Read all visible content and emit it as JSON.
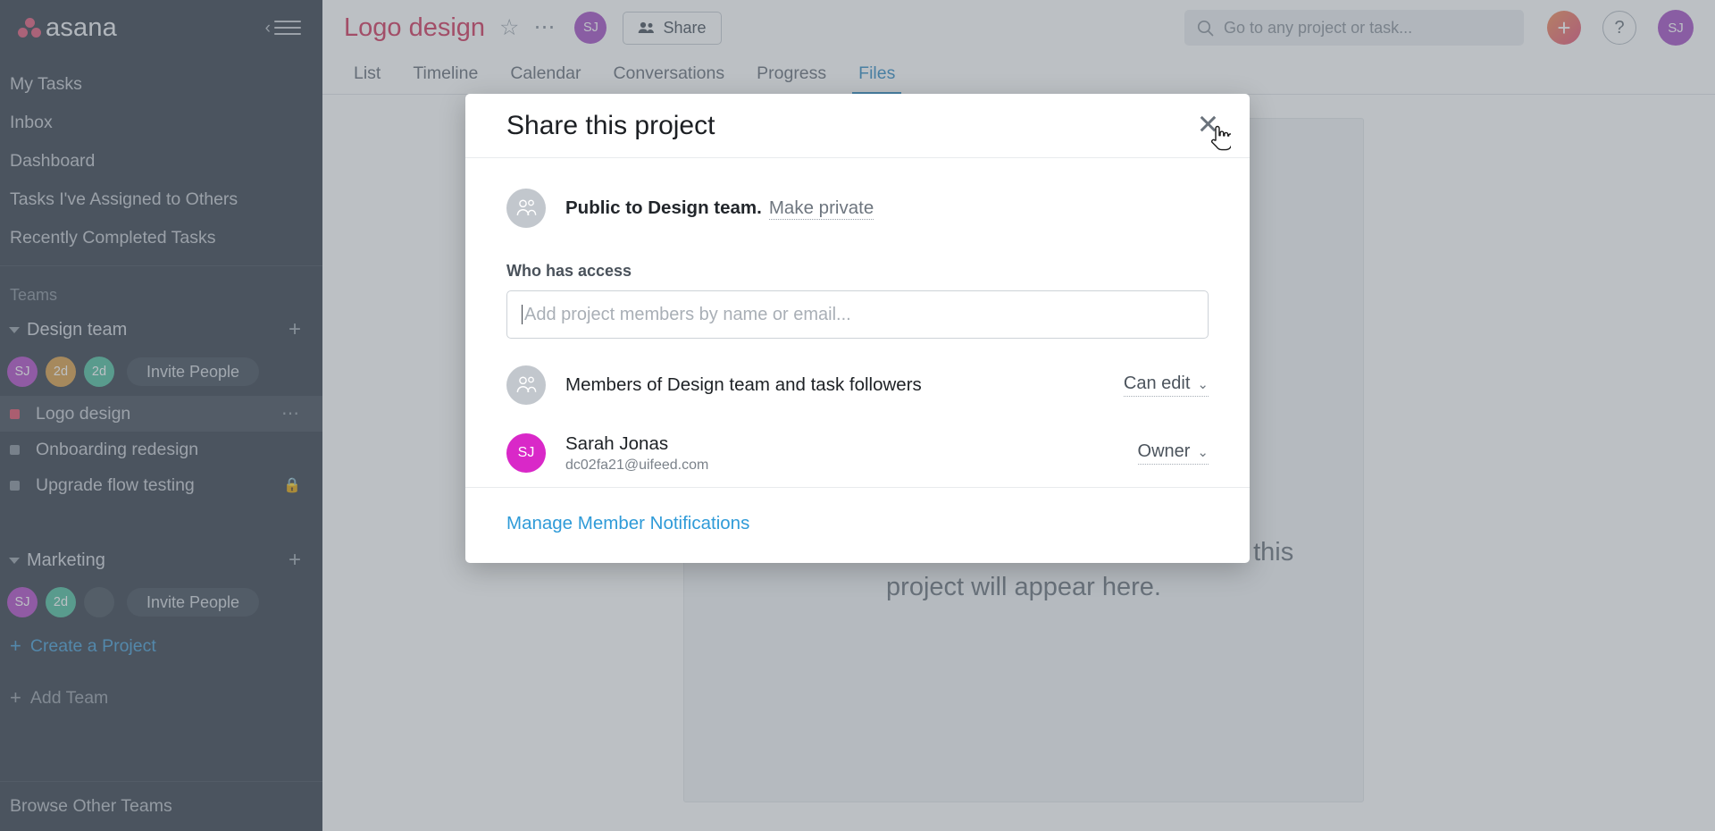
{
  "sidebar": {
    "logo_text": "asana",
    "collapse_icon": "collapse-sidebar-icon",
    "nav": [
      {
        "label": "My Tasks"
      },
      {
        "label": "Inbox"
      },
      {
        "label": "Dashboard"
      },
      {
        "label": "Tasks I've Assigned to Others"
      },
      {
        "label": "Recently Completed Tasks"
      }
    ],
    "teams_label": "Teams",
    "teams": [
      {
        "name": "Design team",
        "add_icon": "plus-icon",
        "avatars": [
          {
            "initials": "SJ",
            "color": "#b452c8"
          },
          {
            "initials": "2d",
            "color": "#daa04e"
          },
          {
            "initials": "2d",
            "color": "#55bfa1"
          }
        ],
        "invite_label": "Invite People",
        "projects": [
          {
            "name": "Logo design",
            "dot_color": "#e0566f",
            "active": true,
            "trailing": "more-options-icon"
          },
          {
            "name": "Onboarding redesign",
            "dot_color": "#8a939d",
            "active": false,
            "trailing": ""
          },
          {
            "name": "Upgrade flow testing",
            "dot_color": "#8a939d",
            "active": false,
            "trailing": "lock-icon"
          }
        ]
      },
      {
        "name": "Marketing",
        "add_icon": "plus-icon",
        "avatars": [
          {
            "initials": "SJ",
            "color": "#b452c8"
          },
          {
            "initials": "2d",
            "color": "#55bfa1"
          },
          {
            "initials": "",
            "color": "#4c5661"
          }
        ],
        "invite_label": "Invite People",
        "projects": []
      }
    ],
    "create_project_label": "Create a Project",
    "add_team_label": "Add Team",
    "browse_teams_label": "Browse Other Teams"
  },
  "header": {
    "project_title": "Logo design",
    "star_icon": "star-icon",
    "more_icon": "more-options-icon",
    "avatar_initials": "SJ",
    "share_label": "Share",
    "share_icon": "people-icon",
    "search_placeholder": "Go to any project or task...",
    "search_icon": "search-icon",
    "add_icon": "plus-icon",
    "help_icon": "question-mark-icon",
    "user_avatar_initials": "SJ"
  },
  "tabs": [
    {
      "label": "List",
      "active": false
    },
    {
      "label": "Timeline",
      "active": false
    },
    {
      "label": "Calendar",
      "active": false
    },
    {
      "label": "Conversations",
      "active": false
    },
    {
      "label": "Progress",
      "active": false
    },
    {
      "label": "Files",
      "active": true
    }
  ],
  "files_view": {
    "empty_message": "All attachments to tasks & conversations in this project will appear here."
  },
  "modal": {
    "title": "Share this project",
    "close_icon": "close-icon",
    "visibility": {
      "icon": "people-group-icon",
      "text": "Public to Design team.",
      "action_label": "Make private"
    },
    "who_has_access_label": "Who has access",
    "add_member_placeholder": "Add project members by name or email...",
    "add_member_value": "",
    "access_rows": [
      {
        "avatar_type": "people-group-icon",
        "avatar_initials": "",
        "avatar_color": "#c2c7cd",
        "name": "Members of Design team and task followers",
        "email": "",
        "role": "Can edit",
        "role_chevron": "chevron-down-icon"
      },
      {
        "avatar_type": "initials",
        "avatar_initials": "SJ",
        "avatar_color": "#d928c8",
        "name": "Sarah Jonas",
        "email": "dc02fa21@uifeed.com",
        "role": "Owner",
        "role_chevron": "chevron-down-icon"
      }
    ],
    "footer_link": "Manage Member Notifications"
  },
  "colors": {
    "sidebar_bg": "#3d4651",
    "accent_blue": "#2f9bd8",
    "project_title": "#d33b61",
    "active_tab": "#3a8fc4"
  }
}
